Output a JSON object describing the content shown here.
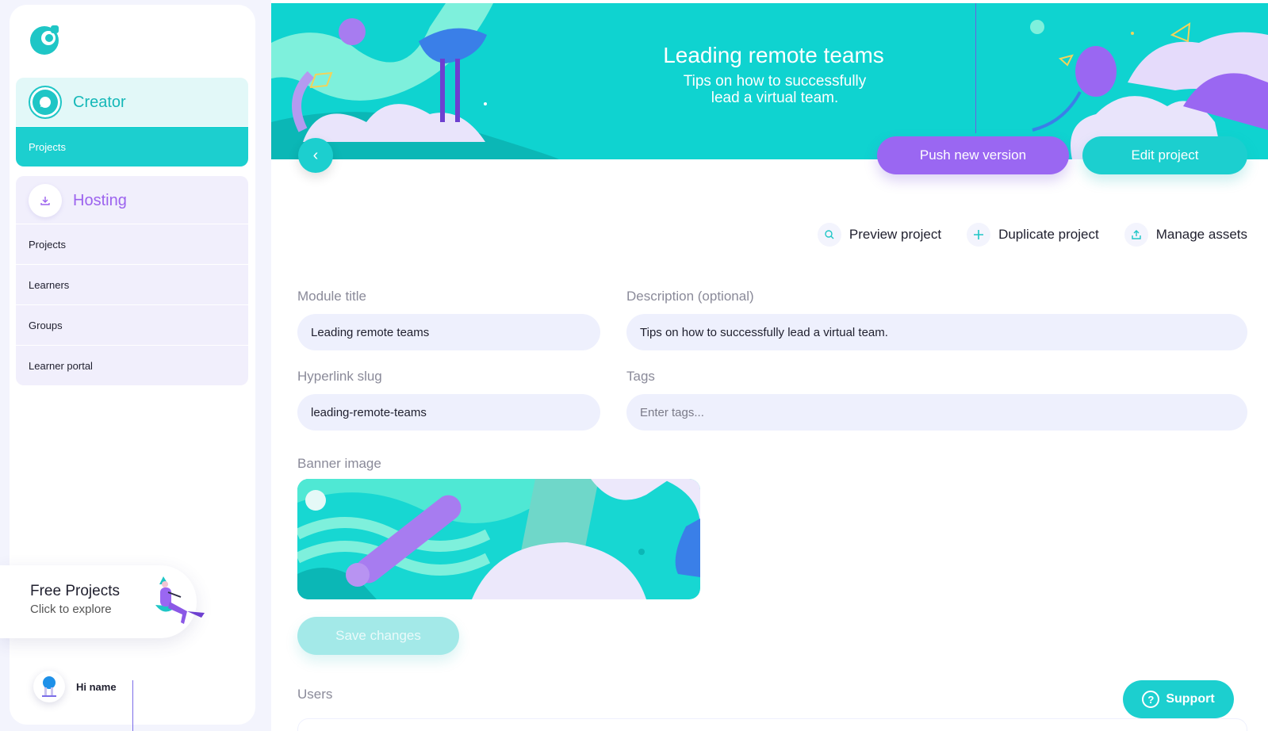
{
  "sidebar": {
    "creator": {
      "title": "Creator",
      "items": [
        {
          "label": "Projects"
        }
      ]
    },
    "hosting": {
      "title": "Hosting",
      "items": [
        {
          "label": "Projects"
        },
        {
          "label": "Learners"
        },
        {
          "label": "Groups"
        },
        {
          "label": "Learner portal"
        }
      ]
    },
    "free_card": {
      "title": "Free Projects",
      "subtitle": "Click to explore"
    },
    "user": {
      "greeting": "Hi name"
    }
  },
  "banner": {
    "title": "Leading remote teams",
    "subtitle": "Tips on how to successfully lead a virtual team.",
    "push_label": "Push new version",
    "edit_label": "Edit project"
  },
  "actions": {
    "preview": "Preview project",
    "duplicate": "Duplicate project",
    "manage": "Manage assets"
  },
  "form": {
    "module_title": {
      "label": "Module title",
      "value": "Leading remote teams"
    },
    "description": {
      "label": "Description (optional)",
      "value": "Tips on how to successfully lead a virtual team."
    },
    "slug": {
      "label": "Hyperlink slug",
      "value": "leading-remote-teams"
    },
    "tags": {
      "label": "Tags",
      "placeholder": "Enter tags..."
    },
    "banner_image": {
      "label": "Banner image"
    },
    "save_label": "Save changes"
  },
  "users": {
    "label": "Users"
  },
  "support": {
    "label": "Support"
  },
  "colors": {
    "teal": "#1ccfcf",
    "purple": "#9a67f2",
    "field": "#eef0fd",
    "background": "#f3f4fd"
  }
}
